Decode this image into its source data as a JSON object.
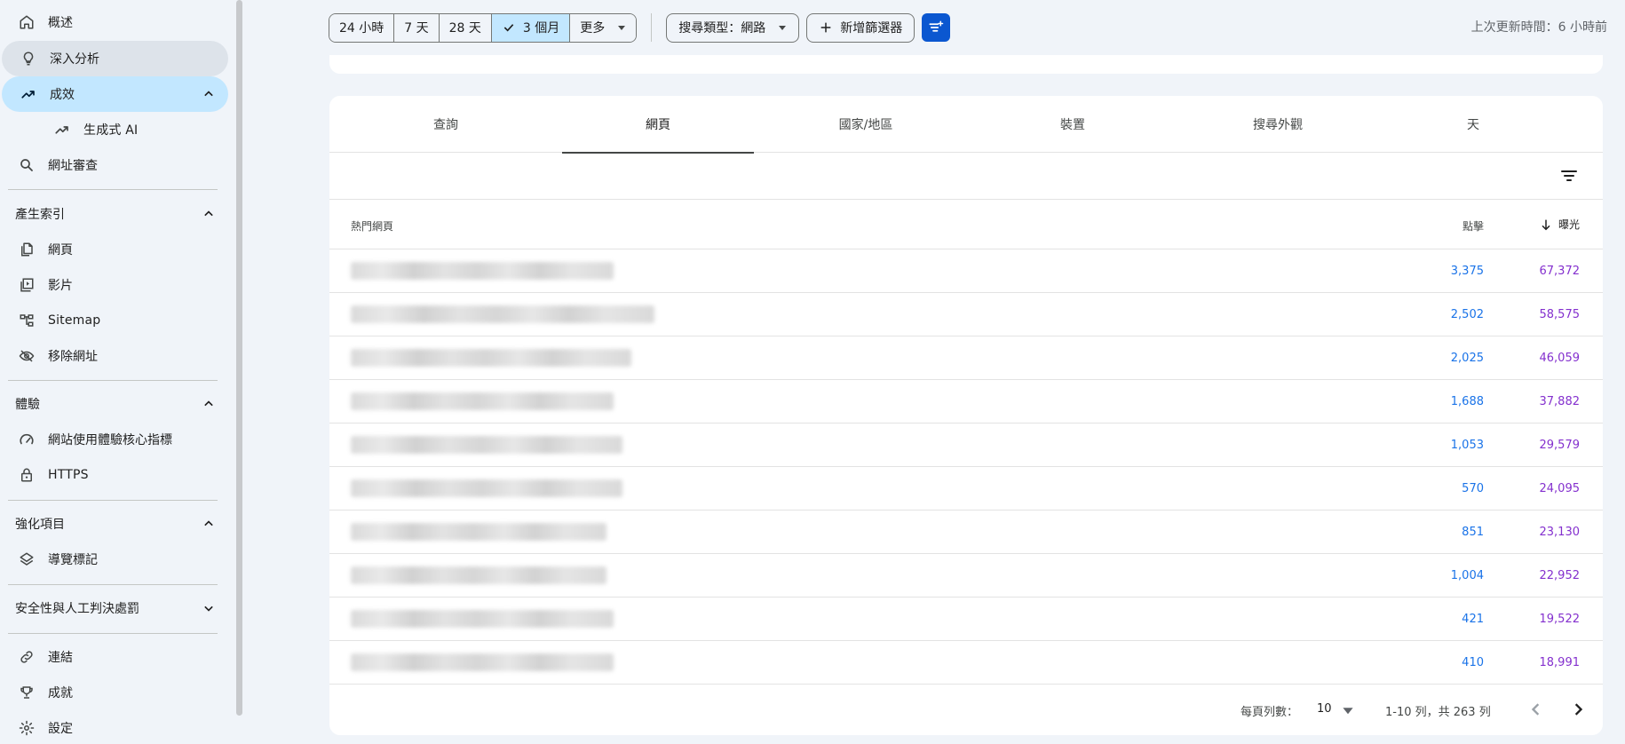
{
  "sidebar": {
    "items": {
      "overview": "概述",
      "insights": "深入分析",
      "performance": "成效",
      "gen_ai": "生成式 AI",
      "url_inspection": "網址審查",
      "pages": "網頁",
      "videos": "影片",
      "sitemaps": "Sitemap",
      "removals": "移除網址",
      "core_web_vitals": "網站使用體驗核心指標",
      "https": "HTTPS",
      "breadcrumbs": "導覽標記",
      "links": "連結",
      "achievements": "成就",
      "settings": "設定"
    },
    "sections": {
      "indexing": "產生索引",
      "experience": "體驗",
      "enhancements": "強化項目",
      "security": "安全性與人工判決處罰"
    }
  },
  "toolbar": {
    "ranges": [
      "24 小時",
      "7 天",
      "28 天",
      "3 個月"
    ],
    "more": "更多",
    "search_type": "搜尋類型：網路",
    "add_filter": "新增篩選器",
    "last_updated": "上次更新時間：6 小時前"
  },
  "tabs": [
    "查詢",
    "網頁",
    "國家/地區",
    "裝置",
    "搜尋外觀",
    "天"
  ],
  "table": {
    "header_page": "熱門網頁",
    "header_clicks": "點擊",
    "header_impressions": "曝光",
    "rows": [
      {
        "clicks": "3,375",
        "impressions": "67,372"
      },
      {
        "clicks": "2,502",
        "impressions": "58,575"
      },
      {
        "clicks": "2,025",
        "impressions": "46,059"
      },
      {
        "clicks": "1,688",
        "impressions": "37,882"
      },
      {
        "clicks": "1,053",
        "impressions": "29,579"
      },
      {
        "clicks": "570",
        "impressions": "24,095"
      },
      {
        "clicks": "851",
        "impressions": "23,130"
      },
      {
        "clicks": "1,004",
        "impressions": "22,952"
      },
      {
        "clicks": "421",
        "impressions": "19,522"
      },
      {
        "clicks": "410",
        "impressions": "18,991"
      }
    ]
  },
  "pager": {
    "rows_per_page_label": "每頁列數：",
    "rows_per_page": "10",
    "range": "1-10 列，共 263 列"
  },
  "colors": {
    "accent": "#0b57d0",
    "active_nav": "#c2e7ff",
    "clicks": "#1a73e8",
    "impressions": "#8430ce"
  }
}
